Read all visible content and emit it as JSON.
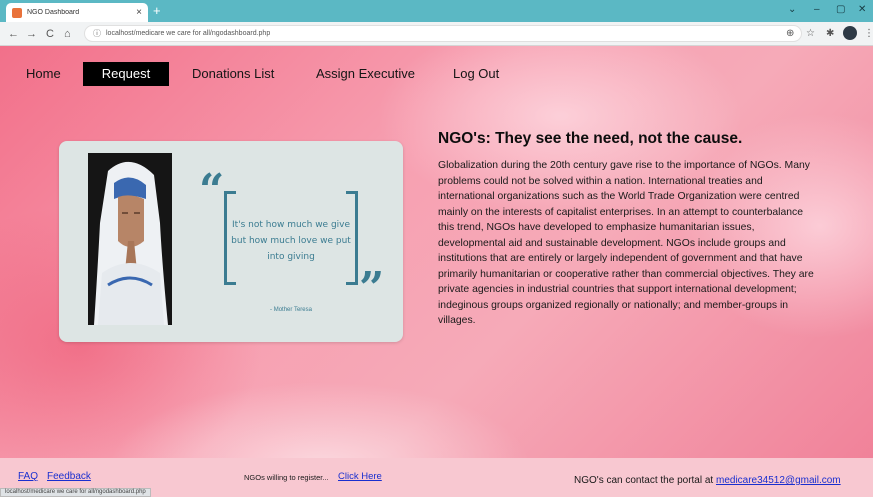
{
  "browser": {
    "tab_title": "NGO Dashboard",
    "tab_close": "×",
    "new_tab": "+",
    "url": "localhost/medicare we care for all/ngodashboard.php",
    "minimize": "⌄",
    "min_btn": "–",
    "max_btn": "▢",
    "close_btn": "✕",
    "back": "←",
    "forward": "→",
    "reload": "C",
    "home": "⌂",
    "info": "ⓘ",
    "share": "⊕",
    "star": "☆",
    "extensions": "✱",
    "menu": "⋮"
  },
  "nav": {
    "home": "Home",
    "request": "Request",
    "donations": "Donations List",
    "assign": "Assign Executive",
    "logout": "Log Out"
  },
  "quote": {
    "open_mark": "“",
    "close_mark": "”",
    "text": "It's not how much we give but how much love we put into giving",
    "author": "- Mother Teresa"
  },
  "article": {
    "title": "NGO's: They see the need, not the cause.",
    "body": "Globalization during the 20th century gave rise to the importance of NGOs. Many problems could not be solved within a nation. International treaties and international organizations such as the World Trade Organization were centred mainly on the interests of capitalist enterprises. In an attempt to counterbalance this trend, NGOs have developed to emphasize humanitarian issues, developmental aid and sustainable development. NGOs include groups and institutions that are entirely or largely independent of government and that have primarily humanitarian or cooperative rather than commercial objectives. They are private agencies in industrial countries that support international development; indeginous groups organized regionally or nationally; and member-groups in villages."
  },
  "footer": {
    "faq": "FAQ",
    "feedback": "Feedback",
    "register_text": "NGOs willing to register...",
    "register_link": "Click Here",
    "contact_text": "NGO's can contact the portal at ",
    "contact_email": "medicare34512@gmail.com",
    "status_url": "localhost/medicare we care for all/ngodashboard.php"
  },
  "colors": {
    "tabbar": "#5bb8c4",
    "page_pink": "#f6a0b2",
    "quote_teal": "#3b7c91",
    "footer": "#f8c8d1",
    "link_blue": "#1a2fcf"
  }
}
